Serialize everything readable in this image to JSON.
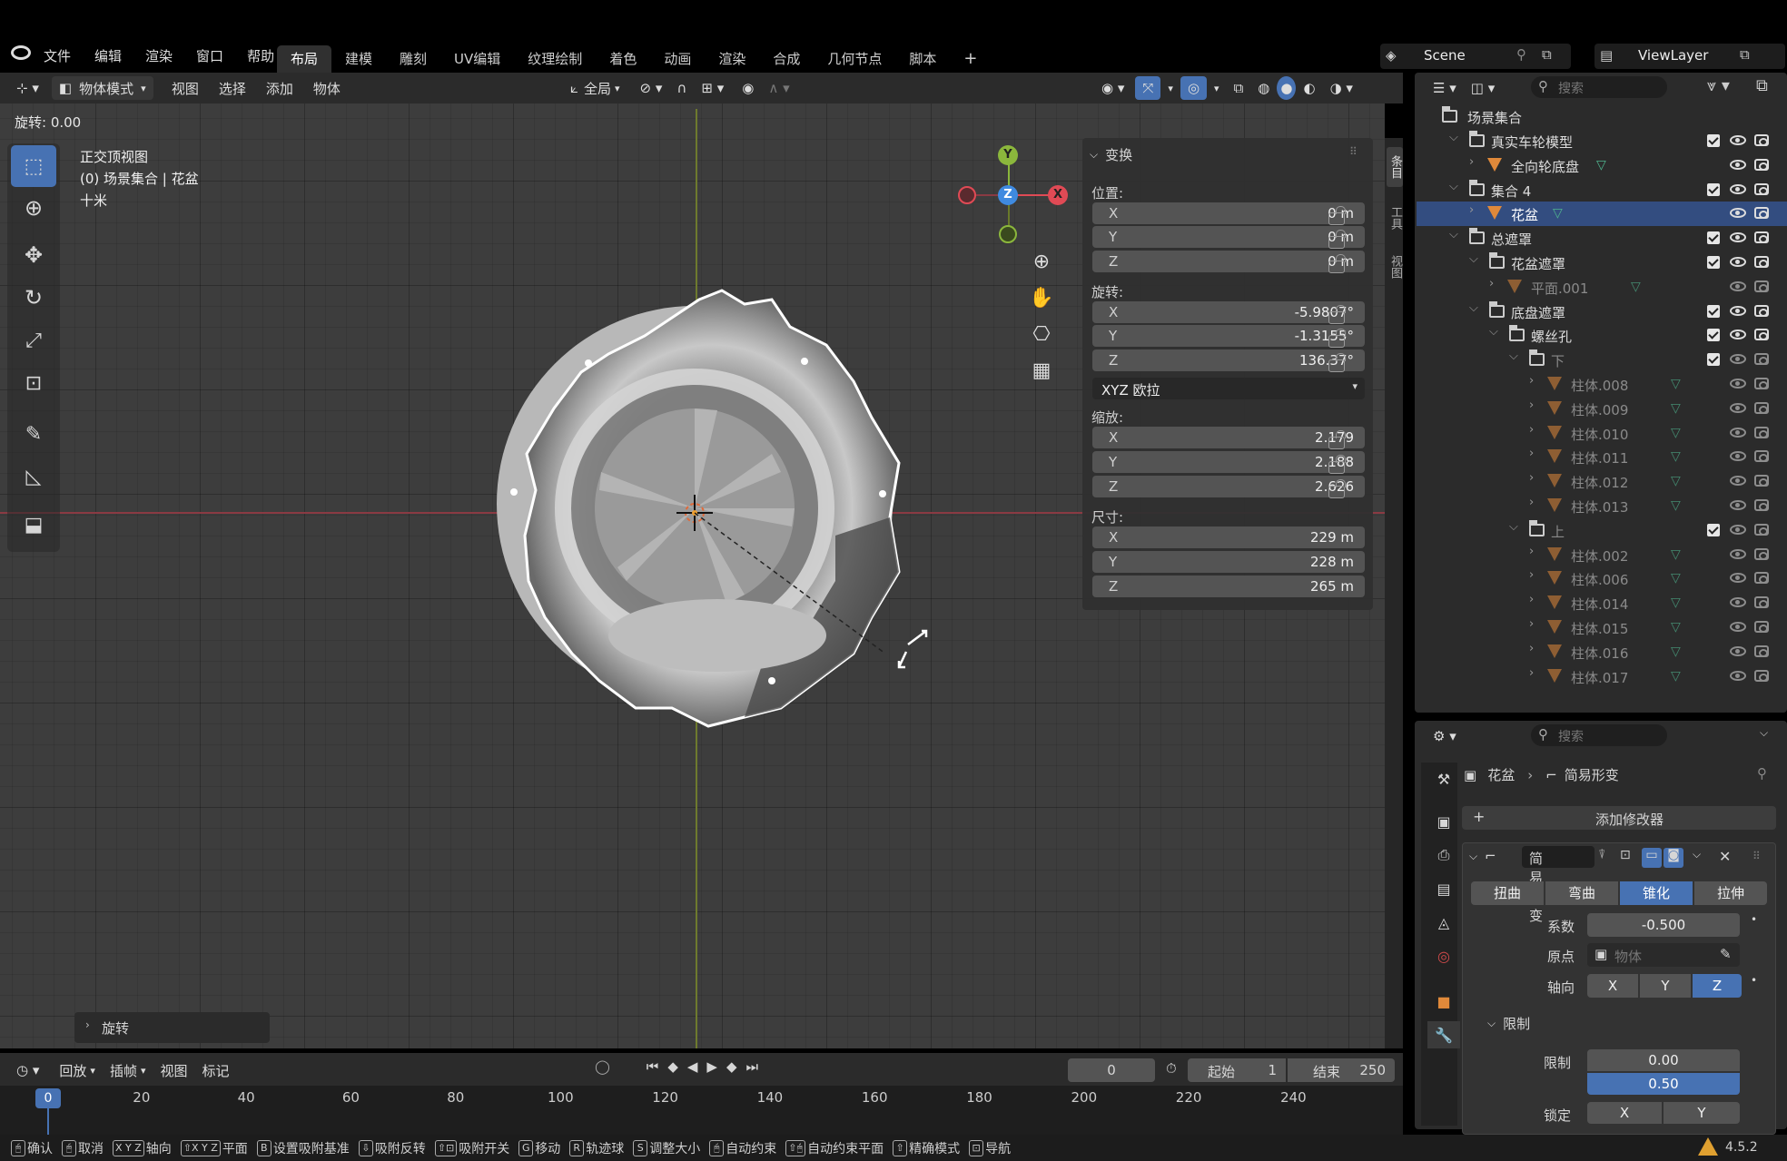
{
  "topbar": {
    "menus": [
      "文件",
      "编辑",
      "渲染",
      "窗口",
      "帮助"
    ],
    "tabs": [
      "布局",
      "建模",
      "雕刻",
      "UV编辑",
      "纹理绘制",
      "着色",
      "动画",
      "渲染",
      "合成",
      "几何节点",
      "脚本"
    ],
    "active_tab_index": 0,
    "add_tab": "+",
    "scene_name": "Scene",
    "view_layer": "ViewLayer"
  },
  "viewport_header": {
    "mode": "物体模式",
    "menus": [
      "视图",
      "选择",
      "添加",
      "物体"
    ],
    "transform_orientation": "全局"
  },
  "operator_status": "旋转: 0.00",
  "viewport_overlay": {
    "view_name": "正交顶视图",
    "collection_object": "(0) 场景集合 | 花盆",
    "scale_label": "十米"
  },
  "gizmo": {
    "y": "Y",
    "z": "Z",
    "x": "X"
  },
  "n_panel": {
    "header": "变换",
    "location_label": "位置:",
    "location": [
      {
        "axis": "X",
        "value": "0 m"
      },
      {
        "axis": "Y",
        "value": "0 m"
      },
      {
        "axis": "Z",
        "value": "0 m"
      }
    ],
    "rotation_label": "旋转:",
    "rotation": [
      {
        "axis": "X",
        "value": "-5.9807°"
      },
      {
        "axis": "Y",
        "value": "-1.3155°"
      },
      {
        "axis": "Z",
        "value": "136.37°"
      }
    ],
    "rotation_mode": "XYZ 欧拉",
    "scale_label": "缩放:",
    "scale": [
      {
        "axis": "X",
        "value": "2.179"
      },
      {
        "axis": "Y",
        "value": "2.188"
      },
      {
        "axis": "Z",
        "value": "2.626"
      }
    ],
    "dimensions_label": "尺寸:",
    "dimensions": [
      {
        "axis": "X",
        "value": "229 m"
      },
      {
        "axis": "Y",
        "value": "228 m"
      },
      {
        "axis": "Z",
        "value": "265 m"
      }
    ],
    "side_tabs": [
      "条目",
      "工具",
      "视图"
    ]
  },
  "last_operator": "旋转",
  "outliner": {
    "search_placeholder": "搜索",
    "root": "场景集合",
    "items": [
      {
        "label": "真实车轮模型",
        "type": "collection",
        "depth": 1,
        "expanded": true,
        "dim": false
      },
      {
        "label": "全向轮底盘",
        "type": "object",
        "depth": 2,
        "expanded": false,
        "dim": false
      },
      {
        "label": "集合 4",
        "type": "collection",
        "depth": 1,
        "expanded": true,
        "dim": false
      },
      {
        "label": "花盆",
        "type": "object",
        "depth": 2,
        "expanded": false,
        "dim": false,
        "selected": true
      },
      {
        "label": "总遮罩",
        "type": "collection",
        "depth": 1,
        "expanded": true,
        "dim": false
      },
      {
        "label": "花盆遮罩",
        "type": "collection",
        "depth": 2,
        "expanded": true,
        "dim": false
      },
      {
        "label": "平面.001",
        "type": "object",
        "depth": 3,
        "expanded": false,
        "dim": true
      },
      {
        "label": "底盘遮罩",
        "type": "collection",
        "depth": 2,
        "expanded": true,
        "dim": false
      },
      {
        "label": "螺丝孔",
        "type": "collection",
        "depth": 3,
        "expanded": true,
        "dim": false
      },
      {
        "label": "下",
        "type": "collection",
        "depth": 4,
        "expanded": true,
        "dim": true
      },
      {
        "label": "柱体.008",
        "type": "object",
        "depth": 5,
        "expanded": false,
        "dim": true
      },
      {
        "label": "柱体.009",
        "type": "object",
        "depth": 5,
        "expanded": false,
        "dim": true
      },
      {
        "label": "柱体.010",
        "type": "object",
        "depth": 5,
        "expanded": false,
        "dim": true
      },
      {
        "label": "柱体.011",
        "type": "object",
        "depth": 5,
        "expanded": false,
        "dim": true
      },
      {
        "label": "柱体.012",
        "type": "object",
        "depth": 5,
        "expanded": false,
        "dim": true
      },
      {
        "label": "柱体.013",
        "type": "object",
        "depth": 5,
        "expanded": false,
        "dim": true
      },
      {
        "label": "上",
        "type": "collection",
        "depth": 4,
        "expanded": true,
        "dim": true
      },
      {
        "label": "柱体.002",
        "type": "object",
        "depth": 5,
        "expanded": false,
        "dim": true
      },
      {
        "label": "柱体.006",
        "type": "object",
        "depth": 5,
        "expanded": false,
        "dim": true
      },
      {
        "label": "柱体.014",
        "type": "object",
        "depth": 5,
        "expanded": false,
        "dim": true
      },
      {
        "label": "柱体.015",
        "type": "object",
        "depth": 5,
        "expanded": false,
        "dim": true
      },
      {
        "label": "柱体.016",
        "type": "object",
        "depth": 5,
        "expanded": false,
        "dim": true
      },
      {
        "label": "柱体.017",
        "type": "object",
        "depth": 5,
        "expanded": false,
        "dim": true
      }
    ]
  },
  "properties": {
    "search_placeholder": "搜索",
    "breadcrumb_object": "花盆",
    "breadcrumb_modifier": "简易形变",
    "add_modifier": "添加修改器",
    "modifier_name": "简易形变",
    "deform_modes": [
      "扭曲",
      "弯曲",
      "锥化",
      "拉伸"
    ],
    "active_mode_index": 2,
    "factor_label": "系数",
    "factor_value": "-0.500",
    "origin_label": "原点",
    "origin_placeholder": "物体",
    "axis_label": "轴向",
    "axes": [
      "X",
      "Y",
      "Z"
    ],
    "active_axis_index": 2,
    "limits_header": "限制",
    "limit_label": "限制",
    "limit_low": "0.00",
    "limit_high": "0.50",
    "lock_label": "锁定",
    "lock_axes": [
      "X",
      "Y"
    ]
  },
  "timeline": {
    "menus": [
      "回放",
      "插帧",
      "视图",
      "标记"
    ],
    "current_frame": "0",
    "start_label": "起始",
    "start_value": "1",
    "end_label": "结束",
    "end_value": "250",
    "ruler": [
      "0",
      "20",
      "40",
      "60",
      "80",
      "100",
      "120",
      "140",
      "160",
      "180",
      "200",
      "220",
      "240"
    ]
  },
  "statusbar": {
    "items": [
      "确认",
      "取消",
      "轴向",
      "平面",
      "设置吸附基准",
      "吸附反转",
      "吸附开关",
      "移动",
      "轨迹球",
      "调整大小",
      "自动约束",
      "自动约束平面",
      "精确模式",
      "导航"
    ],
    "version": "4.5.2"
  }
}
